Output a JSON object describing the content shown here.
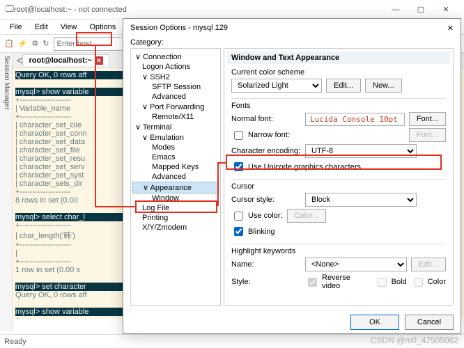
{
  "window": {
    "title": "root@localhost:~ - not connected",
    "minimize": "—",
    "maximize": "▢",
    "close": "✕"
  },
  "menubar": [
    "File",
    "Edit",
    "View",
    "Options",
    "T"
  ],
  "toolbar": {
    "host_placeholder": "Enter host ..."
  },
  "sidetab": "Session Manager",
  "tab": {
    "name": "root@localhost:~",
    "close": "✕"
  },
  "terminal_lines": [
    "Query OK, 0 rows aff",
    "",
    "mysql> show variable",
    "+--------------------",
    "| Variable_name      ",
    "+--------------------",
    "| character_set_clie",
    "| character_set_conn",
    "| character_set_data",
    "| character_set_file",
    "| character_set_resu",
    "| character_set_serv",
    "| character_set_syst",
    "| character_sets_dir",
    "+--------------------",
    "8 rows in set (0.00 ",
    "",
    "mysql> select char_l",
    "+--------------------",
    "| char_length('韩')  ",
    "+--------------------",
    "|                    ",
    "+--------------------",
    "1 row in set (0.00 s",
    "",
    "mysql> set character",
    "Query OK, 0 rows aff",
    "",
    "mysql> show variable",
    "+--------------------",
    "| Variable_name      "
  ],
  "dialog": {
    "title": "Session Options - mysql 129",
    "close": "✕",
    "category": "Category:",
    "tree": [
      {
        "t": "Connection",
        "l": 0,
        "c": "∨"
      },
      {
        "t": "Logon Actions",
        "l": 1
      },
      {
        "t": "SSH2",
        "l": 1,
        "c": "∨"
      },
      {
        "t": "SFTP Session",
        "l": 2
      },
      {
        "t": "Advanced",
        "l": 2
      },
      {
        "t": "Port Forwarding",
        "l": 1,
        "c": "∨"
      },
      {
        "t": "Remote/X11",
        "l": 2
      },
      {
        "t": "Terminal",
        "l": 0,
        "c": "∨"
      },
      {
        "t": "Emulation",
        "l": 1,
        "c": "∨"
      },
      {
        "t": "Modes",
        "l": 2
      },
      {
        "t": "Emacs",
        "l": 2
      },
      {
        "t": "Mapped Keys",
        "l": 2
      },
      {
        "t": "Advanced",
        "l": 2
      },
      {
        "t": "Appearance",
        "l": 1,
        "c": "∨",
        "sel": true
      },
      {
        "t": "Window",
        "l": 2
      },
      {
        "t": "Log File",
        "l": 1
      },
      {
        "t": "Printing",
        "l": 1
      },
      {
        "t": "X/Y/Zmodem",
        "l": 1
      }
    ],
    "form": {
      "header": "Window and Text Appearance",
      "scheme_label": "Current color scheme",
      "scheme_value": "Solarized Light",
      "edit": "Edit...",
      "new": "New...",
      "fonts_label": "Fonts",
      "normal_font": "Normal font:",
      "normal_font_value": "Lucida Console 10pt",
      "font_btn": "Font...",
      "narrow_font": "Narrow font:",
      "char_enc_label": "Character encoding:",
      "char_enc_value": "UTF-8",
      "use_unicode": "Use Unicode graphics characters",
      "cursor_label": "Cursor",
      "cursor_style": "Cursor style:",
      "cursor_style_value": "Block",
      "use_color": "Use color:",
      "color_btn": "Color...",
      "blinking": "Blinking",
      "hl_label": "Highlight keywords",
      "name": "Name:",
      "name_value": "<None>",
      "style": "Style:",
      "reverse": "Reverse video",
      "bold": "Bold",
      "color": "Color"
    },
    "ok": "OK",
    "cancel": "Cancel"
  },
  "status": "Ready",
  "watermark": "CSDN @m0_47505062"
}
